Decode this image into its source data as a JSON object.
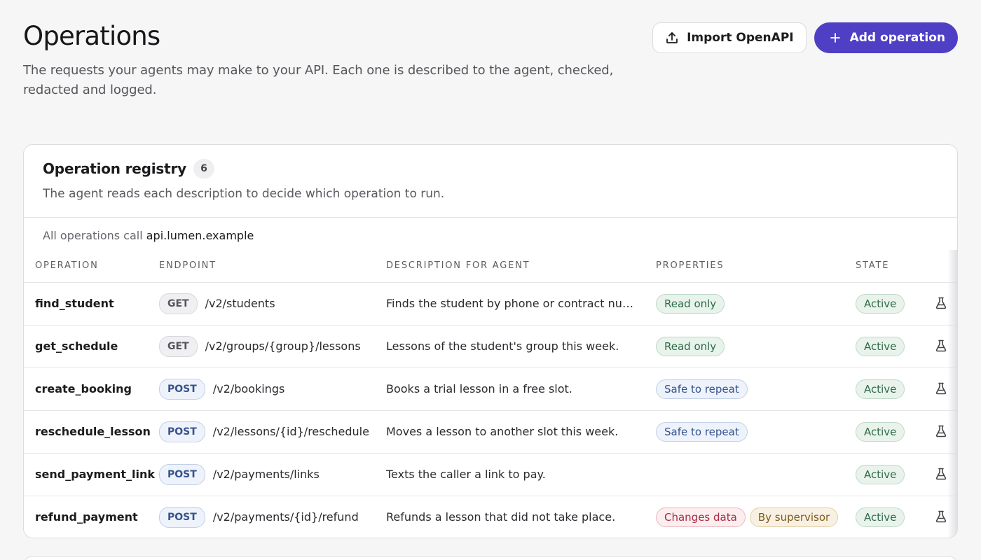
{
  "header": {
    "title": "Operations",
    "subtitle": "The requests your agents may make to your API. Each one is described to the agent, checked, redacted and logged.",
    "import_label": "Import OpenAPI",
    "add_label": "Add operation"
  },
  "registry": {
    "title": "Operation registry",
    "count": "6",
    "description": "The agent reads each description to decide which operation to run.",
    "base_prefix": "All operations call",
    "base_host": "api.lumen.example",
    "columns": [
      "OPERATION",
      "ENDPOINT",
      "DESCRIPTION FOR AGENT",
      "PROPERTIES",
      "STATE"
    ],
    "rows": [
      {
        "name": "find_student",
        "method": "GET",
        "path": "/v2/students",
        "description": "Finds the student by phone or contract numb…",
        "properties": [
          "Read only"
        ],
        "state": "Active"
      },
      {
        "name": "get_schedule",
        "method": "GET",
        "path": "/v2/groups/{group}/lessons",
        "description": "Lessons of the student's group this week.",
        "properties": [
          "Read only"
        ],
        "state": "Active"
      },
      {
        "name": "create_booking",
        "method": "POST",
        "path": "/v2/bookings",
        "description": "Books a trial lesson in a free slot.",
        "properties": [
          "Safe to repeat"
        ],
        "state": "Active"
      },
      {
        "name": "reschedule_lesson",
        "method": "POST",
        "path": "/v2/lessons/{id}/reschedule",
        "description": "Moves a lesson to another slot this week.",
        "properties": [
          "Safe to repeat"
        ],
        "state": "Active"
      },
      {
        "name": "send_payment_link",
        "method": "POST",
        "path": "/v2/payments/links",
        "description": "Texts the caller a link to pay.",
        "properties": [],
        "state": "Active"
      },
      {
        "name": "refund_payment",
        "method": "POST",
        "path": "/v2/payments/{id}/refund",
        "description": "Refunds a lesson that did not take place.",
        "properties": [
          "Changes data",
          "By supervisor"
        ],
        "state": "Active"
      }
    ]
  },
  "colors": {
    "primary": "#4f3fc4",
    "background": "#f6f6f6"
  },
  "icons": {
    "import": "upload-icon",
    "add": "plus-icon",
    "test": "flask-icon"
  }
}
